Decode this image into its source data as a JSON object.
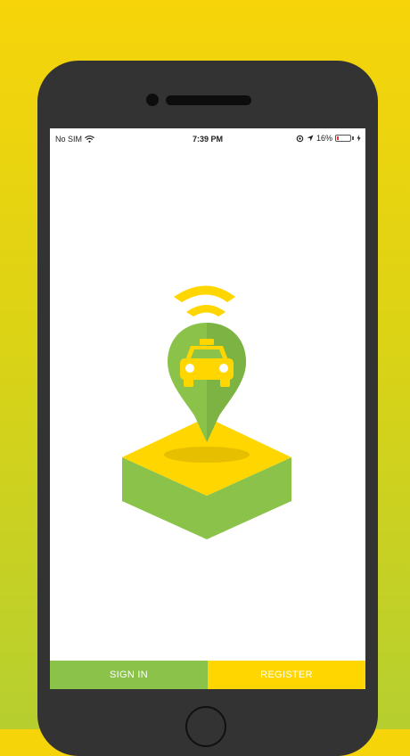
{
  "status_bar": {
    "carrier": "No SIM",
    "time": "7:39 PM",
    "battery_percent": "16%",
    "battery_level": 0.16,
    "icons": [
      "wifi-icon",
      "location-icon",
      "navigation-icon",
      "battery-icon",
      "charging-icon"
    ]
  },
  "logo": {
    "icon": "taxi-location-pin-icon"
  },
  "actions": {
    "sign_in_label": "SIGN IN",
    "register_label": "REGISTER"
  },
  "colors": {
    "green": "#8bc34a",
    "yellow": "#ffd600",
    "phone_body": "#333333"
  }
}
